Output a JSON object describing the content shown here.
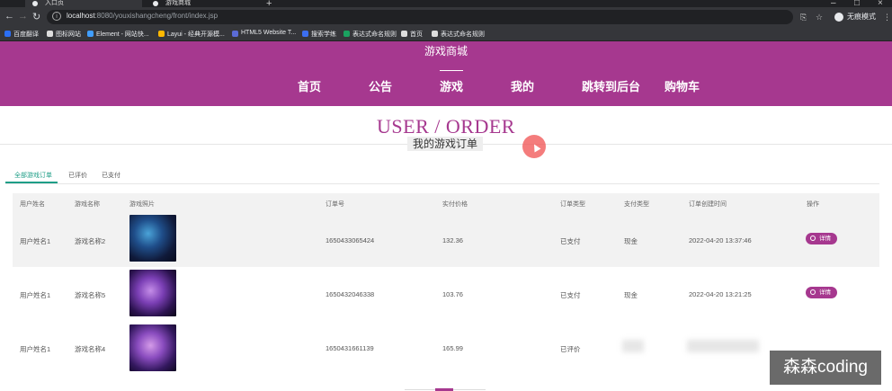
{
  "browser": {
    "tabs": [
      {
        "label": "入口页",
        "active": true
      },
      {
        "label": "游戏商城",
        "active": false
      }
    ],
    "new_tab": "+",
    "window_controls": [
      "–",
      "□",
      "×"
    ],
    "url_host": "localhost",
    "url_rest": ":8080/youxishangcheng/front/index.jsp",
    "incognito_label": "无痕模式",
    "bookmarks": [
      {
        "label": "百度翻译",
        "color": "#2b6ff5"
      },
      {
        "label": "图标网站",
        "color": "#dddddd"
      },
      {
        "label": "Element - 网站快...",
        "color": "#409eff"
      },
      {
        "label": "Layui - 经典开源模...",
        "color": "#ffb800"
      },
      {
        "label": "HTML5 Website T...",
        "color": "#5b6bd6"
      },
      {
        "label": "搜索学练",
        "color": "#3c6ef0"
      },
      {
        "label": "表达式命名规则",
        "color": "#1aa260"
      },
      {
        "label": "首页",
        "color": "#dddddd"
      },
      {
        "label": "表达式命名规则",
        "color": "#dddddd"
      }
    ]
  },
  "site": {
    "title": "游戏商城",
    "nav": [
      {
        "label": "首页",
        "active": false
      },
      {
        "label": "公告",
        "active": false
      },
      {
        "label": "游戏",
        "active": true
      },
      {
        "label": "我的",
        "active": false
      },
      {
        "label": "跳转到后台",
        "active": false
      },
      {
        "label": "购物车",
        "active": false
      }
    ],
    "brand_color": "#a6388f"
  },
  "page": {
    "heading": "USER / ORDER",
    "subheading": "我的游戏订单"
  },
  "order_tabs": [
    {
      "label": "全部游戏订单",
      "active": true
    },
    {
      "label": "已评价",
      "active": false
    },
    {
      "label": "已支付",
      "active": false
    }
  ],
  "table": {
    "headers": [
      "用户姓名",
      "游戏名称",
      "游戏照片",
      "订单号",
      "实付价格",
      "订单类型",
      "支付类型",
      "订单创建时间",
      "操作"
    ],
    "rows": [
      {
        "user": "用户姓名1",
        "game": "游戏名称2",
        "order_no": "1650433065424",
        "price": "132.36",
        "order_type": "已支付",
        "pay_type": "现金",
        "created": "2022-04-20 13:37:46",
        "action": "详情"
      },
      {
        "user": "用户姓名1",
        "game": "游戏名称5",
        "order_no": "1650432046338",
        "price": "103.76",
        "order_type": "已支付",
        "pay_type": "现金",
        "created": "2022-04-20 13:21:25",
        "action": "详情"
      },
      {
        "user": "用户姓名1",
        "game": "游戏名称4",
        "order_no": "1650431661139",
        "price": "165.99",
        "order_type": "已评价",
        "pay_type": "",
        "created": "",
        "action": ""
      }
    ]
  },
  "watermark": "森森coding"
}
